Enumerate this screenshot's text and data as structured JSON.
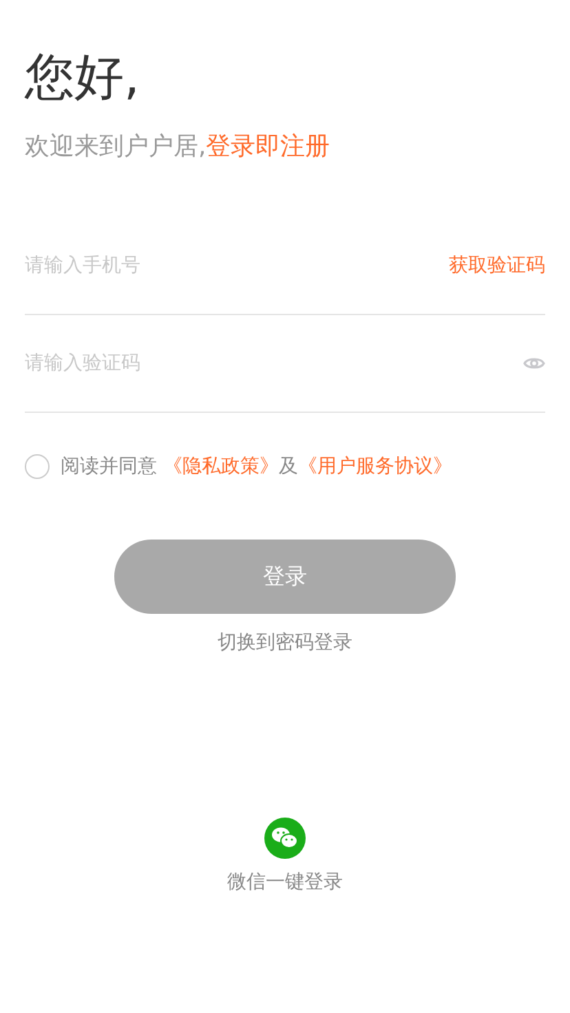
{
  "greeting": "您好,",
  "subtitle": {
    "text": "欢迎来到户户居,",
    "link": "登录即注册"
  },
  "phone_field": {
    "placeholder": "请输入手机号",
    "action": "获取验证码"
  },
  "code_field": {
    "placeholder": "请输入验证码"
  },
  "agreement": {
    "checked": false,
    "prefix": "阅读并同意",
    "link_1": "《隐私政策》",
    "middle": "及",
    "link_2": "《用户服务协议》"
  },
  "login_button": {
    "label": "登录",
    "disabled": true
  },
  "switch_link": "切换到密码登录",
  "wechat_login": {
    "label": "微信一键登录"
  }
}
